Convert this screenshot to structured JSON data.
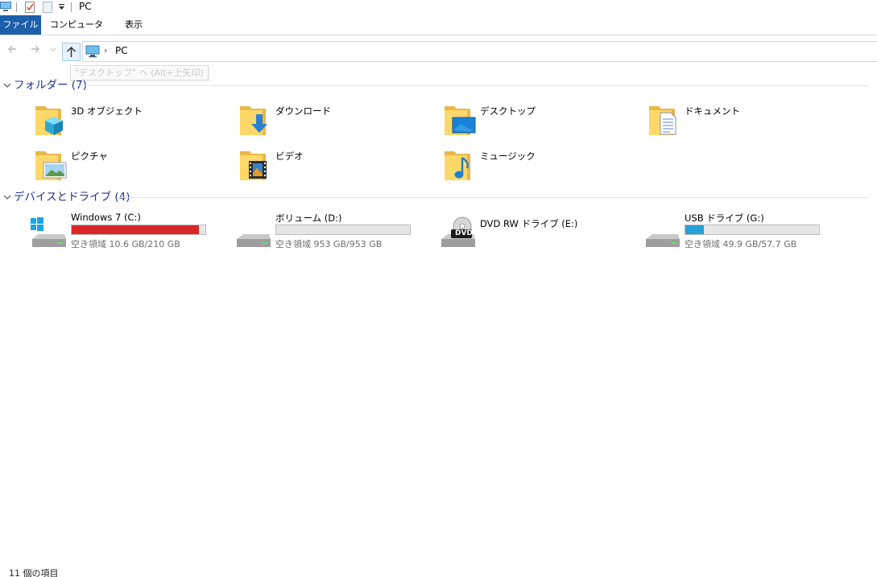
{
  "window": {
    "title": "PC"
  },
  "quick_access": [
    "computer-icon",
    "properties-icon",
    "new-folder-icon",
    "customize-dropdown-icon"
  ],
  "ribbon": {
    "tabs": [
      "ファイル",
      "コンピューター",
      "表示"
    ]
  },
  "nav": {
    "address_path": "PC",
    "up_tooltip": "\"デスクトップ\" へ (Alt+上矢印)"
  },
  "groups": {
    "folders": {
      "title": "フォルダー (7)",
      "items": [
        {
          "label": "3D オブジェクト",
          "icon": "3d-objects-folder-icon"
        },
        {
          "label": "ダウンロード",
          "icon": "downloads-folder-icon"
        },
        {
          "label": "デスクトップ",
          "icon": "desktop-folder-icon"
        },
        {
          "label": "ドキュメント",
          "icon": "documents-folder-icon"
        },
        {
          "label": "ピクチャ",
          "icon": "pictures-folder-icon"
        },
        {
          "label": "ビデオ",
          "icon": "videos-folder-icon"
        },
        {
          "label": "ミュージック",
          "icon": "music-folder-icon"
        }
      ]
    },
    "drives": {
      "title": "デバイスとドライブ (4)",
      "items": [
        {
          "name": "Windows 7 (C:)",
          "free": "空き領域 10.6 GB/210 GB",
          "used_fraction": 0.95,
          "bar_color": "#da2626",
          "icon": "windows-drive-icon"
        },
        {
          "name": "ボリューム (D:)",
          "free": "空き領域 953 GB/953 GB",
          "used_fraction": 0.0,
          "bar_color": "#26a0da",
          "icon": "hard-drive-icon"
        },
        {
          "name": "DVD RW ドライブ (E:)",
          "free": "",
          "icon": "dvd-drive-icon"
        },
        {
          "name": "USB ドライブ (G:)",
          "free": "空き領域 49.9 GB/57.7 GB",
          "used_fraction": 0.14,
          "bar_color": "#26a0da",
          "icon": "usb-drive-icon"
        }
      ]
    }
  },
  "dvd_badge": "DVD",
  "status_bar": {
    "item_count": "11 個の項目"
  },
  "colors": {
    "accent": "#1c5ea8",
    "group_title": "#1e3287",
    "low_space": "#da2626",
    "normal_space": "#26a0da"
  }
}
